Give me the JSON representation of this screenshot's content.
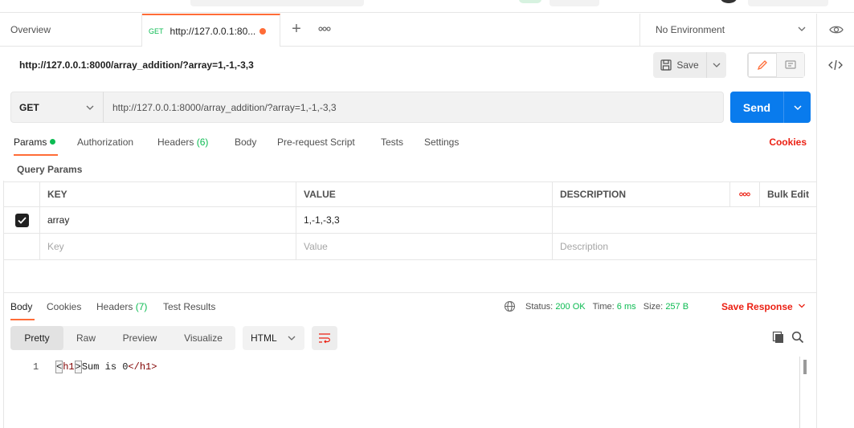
{
  "tabbar": {
    "overview_label": "Overview",
    "active_tab": {
      "method": "GET",
      "title": "http://127.0.0.1:80..."
    },
    "environment": "No Environment"
  },
  "request": {
    "title": "http://127.0.0.1:8000/array_addition/?array=1,-1,-3,3",
    "save_label": "Save",
    "method": "GET",
    "url": "http://127.0.0.1:8000/array_addition/?array=1,-1,-3,3",
    "send_label": "Send"
  },
  "request_tabs": {
    "params": "Params",
    "authorization": "Authorization",
    "headers": "Headers",
    "headers_count": "(6)",
    "body": "Body",
    "prerequest": "Pre-request Script",
    "tests": "Tests",
    "settings": "Settings",
    "cookies": "Cookies"
  },
  "query_params": {
    "label": "Query Params",
    "headers": {
      "key": "KEY",
      "value": "VALUE",
      "description": "DESCRIPTION",
      "bulk_edit": "Bulk Edit"
    },
    "rows": [
      {
        "key": "array",
        "value": "1,-1,-3,3",
        "description": "",
        "checked": true
      }
    ],
    "placeholder": {
      "key": "Key",
      "value": "Value",
      "description": "Description"
    }
  },
  "response": {
    "tabs": {
      "body": "Body",
      "cookies": "Cookies",
      "headers": "Headers",
      "headers_count": "(7)",
      "test_results": "Test Results"
    },
    "status_label": "Status:",
    "status_value": "200 OK",
    "time_label": "Time:",
    "time_value": "6 ms",
    "size_label": "Size:",
    "size_value": "257 B",
    "save_response": "Save Response",
    "view_modes": [
      "Pretty",
      "Raw",
      "Preview",
      "Visualize"
    ],
    "active_view": "Pretty",
    "language": "HTML",
    "line_number": "1",
    "code": {
      "open_lt": "<",
      "open_tag": "h1",
      "open_gt": ">",
      "text": "Sum is 0",
      "close_tag": "</h1>"
    }
  },
  "colors": {
    "accent": "#ff6c37",
    "send_blue": "#097bed",
    "success_green": "#0cbb52",
    "link_red": "#eb2013"
  }
}
